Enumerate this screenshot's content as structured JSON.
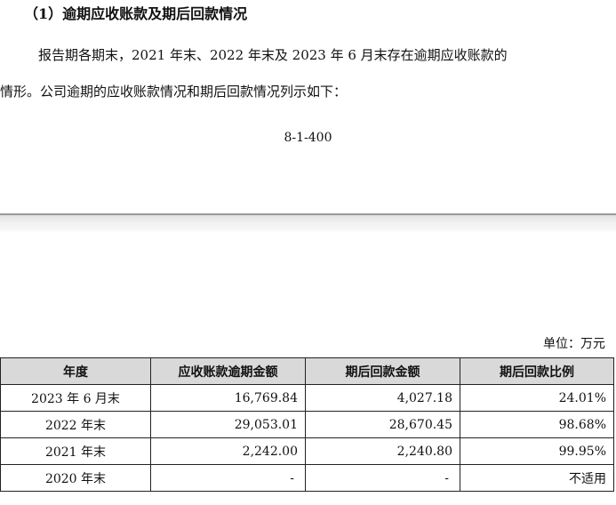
{
  "heading": "（1）逾期应收账款及期后回款情况",
  "paragraph_line1": "报告期各期末，2021 年末、2022 年末及 2023 年 6 月末存在逾期应收账款的",
  "paragraph_line2": "情形。公司逾期的应收账款情况和期后回款情况列示如下：",
  "page_number": "8-1-400",
  "unit_label": "单位：万元",
  "table": {
    "headers": [
      "年度",
      "应收账款逾期金额",
      "期后回款金额",
      "期后回款比例"
    ],
    "rows": [
      {
        "year": "2023 年 6 月末",
        "overdue": "16,769.84",
        "collected": "4,027.18",
        "ratio": "24.01%"
      },
      {
        "year": "2022 年末",
        "overdue": "29,053.01",
        "collected": "28,670.45",
        "ratio": "98.68%"
      },
      {
        "year": "2021 年末",
        "overdue": "2,242.00",
        "collected": "2,240.80",
        "ratio": "99.95%"
      },
      {
        "year": "2020 年末",
        "overdue": "-",
        "collected": "-",
        "ratio": "不适用"
      }
    ]
  }
}
